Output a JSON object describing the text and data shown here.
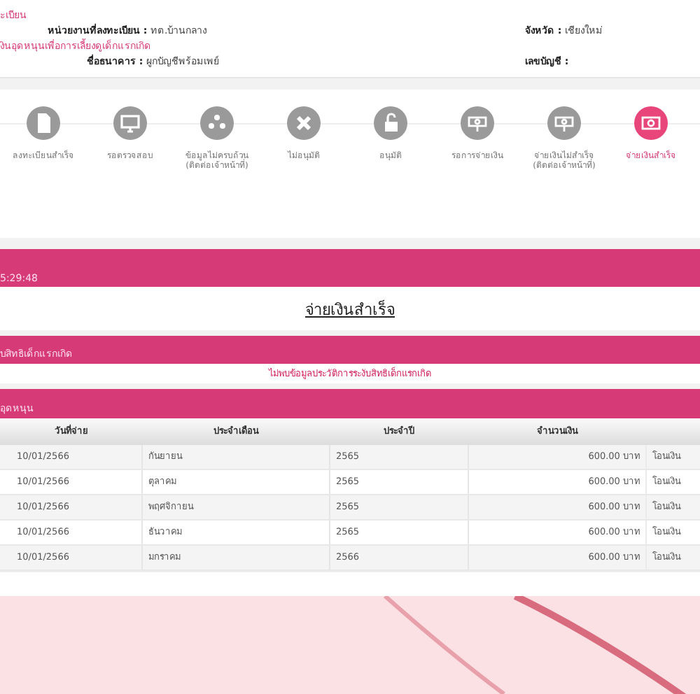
{
  "registration": {
    "heading": "ะเบียน",
    "agency_label": "หน่วยงานที่ลงทะเบียน :",
    "agency_value": "ทต.บ้านกลาง",
    "province_label": "จังหวัด :",
    "province_value": "เชียงใหม่"
  },
  "subsidy": {
    "heading": "งินอุดหนุนเพื่อการเลี้ยงดูเด็กแรกเกิด",
    "bank_label": "ชื่อธนาคาร :",
    "bank_value": "ผูกบัญชีพร้อมเพย์",
    "account_label": "เลขบัญชี :"
  },
  "steps": [
    {
      "kind": "document",
      "label": "ลงทะเบียนสำเร็จ",
      "selected": false
    },
    {
      "kind": "monitor",
      "label": "รอตรวจสอบ",
      "selected": false
    },
    {
      "kind": "people",
      "label": "ข้อมูลไม่ครบถ้วน (ติดต่อเจ้าหน้าที่)",
      "selected": false
    },
    {
      "kind": "cross",
      "label": "ไม่อนุมัติ",
      "selected": false
    },
    {
      "kind": "lock",
      "label": "อนุมัติ",
      "selected": false
    },
    {
      "kind": "money",
      "label": "รอการจ่ายเงิน",
      "selected": false
    },
    {
      "kind": "money",
      "label": "จ่ายเงินไม่สำเร็จ (ติดต่อเจ้าหน้าที่)",
      "selected": false
    },
    {
      "kind": "cash",
      "label": "จ่ายเงินสำเร็จ",
      "selected": true
    }
  ],
  "time_bar": {
    "time": "5:29:48"
  },
  "status_title": "จ่ายเงินสำเร็จ",
  "suspension": {
    "heading": "บสิทธิเด็กแรกเกิด",
    "message": "ไม่พบข้อมูลประวัติการระงับสิทธิเด็กแรกเกิด"
  },
  "payments": {
    "heading": "อุดหนุน",
    "columns": [
      "วันที่จ่าย",
      "ประจำเดือน",
      "ประจำปี",
      "จำนวนเงิน"
    ],
    "rows": [
      [
        "10/01/2566",
        "กันยายน",
        "2565",
        "600.00 บาท",
        "โอนเงิน"
      ],
      [
        "10/01/2566",
        "ตุลาคม",
        "2565",
        "600.00 บาท",
        "โอนเงิน"
      ],
      [
        "10/01/2566",
        "พฤศจิกายน",
        "2565",
        "600.00 บาท",
        "โอนเงิน"
      ],
      [
        "10/01/2566",
        "ธันวาคม",
        "2565",
        "600.00 บาท",
        "โอนเงิน"
      ],
      [
        "10/01/2566",
        "มกราคม",
        "2566",
        "600.00 บาท",
        "โอนเงิน"
      ]
    ]
  }
}
